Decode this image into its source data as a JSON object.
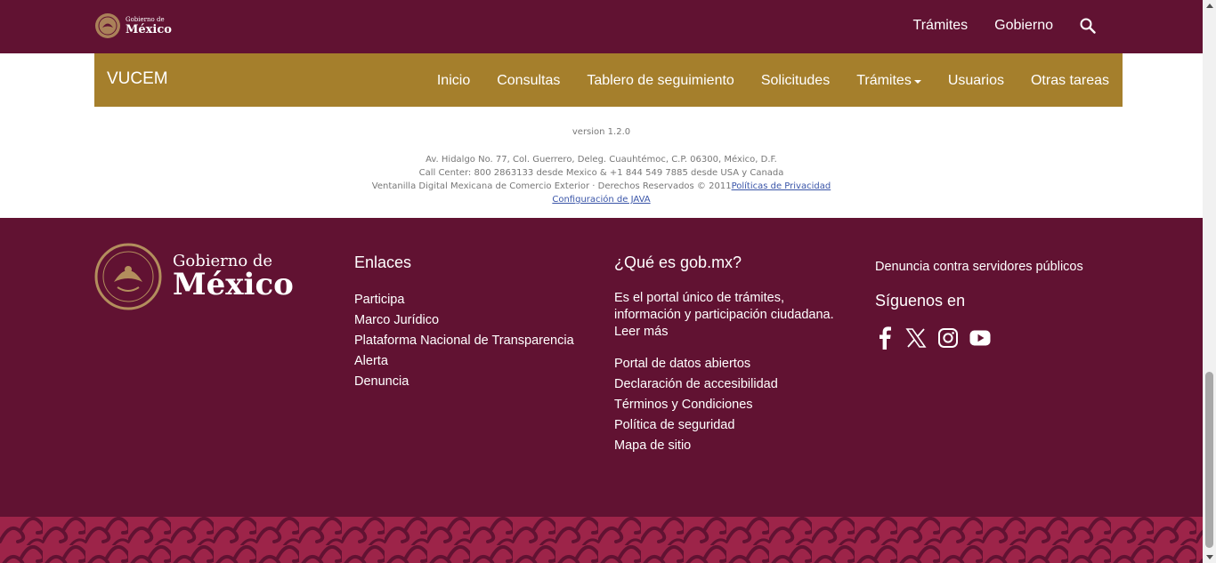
{
  "gov_bar": {
    "logo": {
      "small": "Gobierno de",
      "big": "México"
    },
    "nav": [
      "Trámites",
      "Gobierno"
    ],
    "search_icon": "search-icon",
    "bg": "#611232"
  },
  "vucem": {
    "brand": "VUCEM",
    "nav": [
      "Inicio",
      "Consultas",
      "Tablero de seguimiento",
      "Solicitudes",
      "Trámites",
      "Usuarios",
      "Otras tareas"
    ],
    "bg": "#a57f2c"
  },
  "info": {
    "version": "version 1.2.0",
    "address": "Av. Hidalgo No. 77, Col. Guerrero, Deleg. Cuauhtémoc, C.P. 06300, México, D.F.",
    "call_center": "Call Center: 800 2863133 desde Mexico & +1 844 549 7885 desde USA y Canada",
    "rights": "Ventanilla Digital Mexicana de Comercio Exterior · Derechos Reservados © 2011",
    "privacy_link": "Políticas de Privacidad",
    "java_link": "Configuración de JAVA"
  },
  "footer": {
    "logo": {
      "small": "Gobierno de",
      "big": "México"
    },
    "enlaces": {
      "title": "Enlaces",
      "items": [
        "Participa",
        "Marco Jurídico",
        "Plataforma Nacional de Transparencia",
        "Alerta",
        "Denuncia"
      ]
    },
    "que_es": {
      "title": "¿Qué es gob.mx?",
      "description": "Es el portal único de trámites, información y participación ciudadana.",
      "read_more": "Leer más",
      "items": [
        "Portal de datos abiertos",
        "Declaración de accesibilidad",
        "Términos y Condiciones",
        "Política de seguridad",
        "Mapa de sitio"
      ]
    },
    "denuncia": "Denuncia contra servidores públicos",
    "siguenos": "Síguenos en",
    "social": [
      "facebook-icon",
      "x-icon",
      "instagram-icon",
      "youtube-icon"
    ]
  }
}
